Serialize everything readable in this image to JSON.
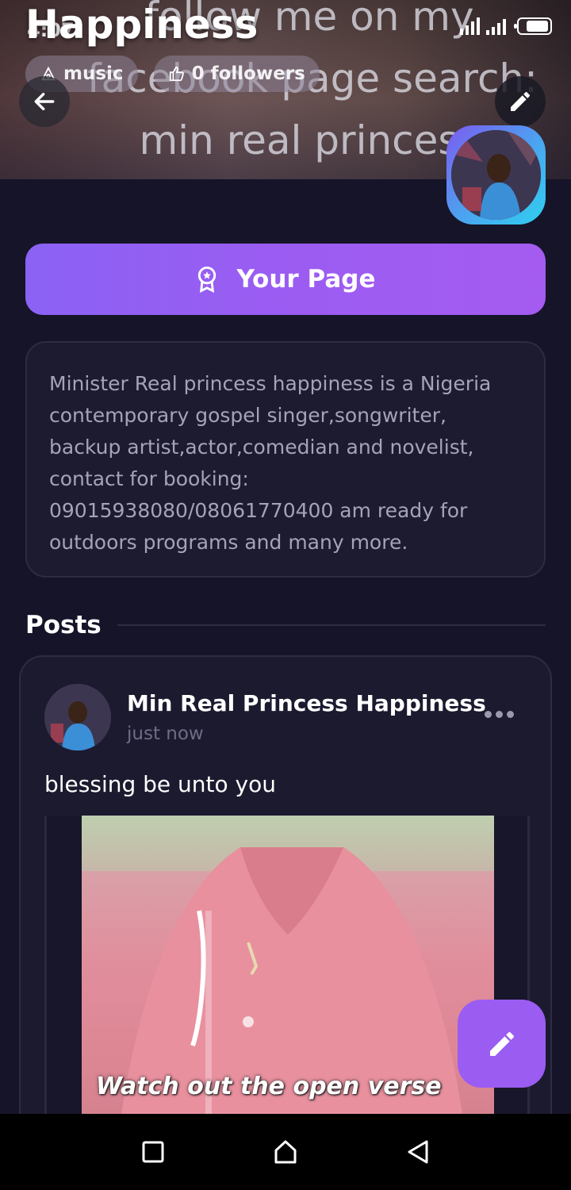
{
  "status_bar": {
    "time": "4:07"
  },
  "cover": {
    "overlay_text": "follow me on my\nfacebook page search:\nmin real princess"
  },
  "page": {
    "title": "Happiness",
    "category": "music",
    "followers": "0 followers"
  },
  "actions": {
    "your_page_label": "Your Page"
  },
  "bio": {
    "text": "Minister Real princess happiness is a Nigeria contemporary gospel singer,songwriter, backup artist,actor,comedian and novelist, contact for booking: 09015938080/08061770400 am ready for outdoors programs and many more."
  },
  "posts": {
    "heading": "Posts",
    "items": [
      {
        "author": "Min Real Princess Happiness",
        "time": "just now",
        "text": "blessing be unto you",
        "media_caption": "Watch out the open verse"
      }
    ]
  },
  "colors": {
    "background": "#151428",
    "accent": "#9b5cf2",
    "card": "#1c1b30",
    "muted_text": "#a5a3b8"
  },
  "icons": {
    "back": "arrow-left-icon",
    "edit": "pencil-icon",
    "category": "music-icon",
    "followers": "thumbs-up-icon",
    "your_page": "award-badge-icon",
    "post_menu": "more-horizontal-icon",
    "fab": "pencil-icon"
  }
}
